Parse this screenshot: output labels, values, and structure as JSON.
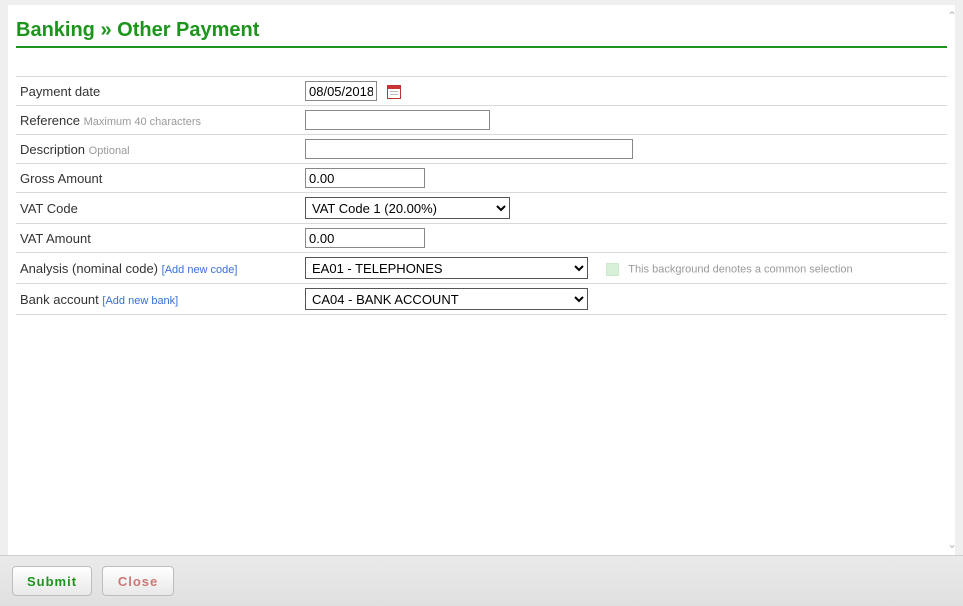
{
  "title": "Banking » Other Payment",
  "rows": {
    "payment_date": {
      "label": "Payment date",
      "value": "08/05/2018"
    },
    "reference": {
      "label": "Reference",
      "hint": "Maximum 40 characters",
      "value": ""
    },
    "description": {
      "label": "Description",
      "hint": "Optional",
      "value": ""
    },
    "gross_amount": {
      "label": "Gross Amount",
      "value": "0.00"
    },
    "vat_code": {
      "label": "VAT Code",
      "value": "VAT Code 1 (20.00%)"
    },
    "vat_amount": {
      "label": "VAT Amount",
      "value": "0.00"
    },
    "analysis": {
      "label": "Analysis (nominal code)",
      "link": "[Add new code]",
      "value": "EA01 - TELEPHONES",
      "legend": "This background denotes a common selection"
    },
    "bank_account": {
      "label": "Bank account",
      "link": "[Add new bank]",
      "value": "CA04 - BANK ACCOUNT"
    }
  },
  "buttons": {
    "submit": "Submit",
    "close": "Close"
  }
}
